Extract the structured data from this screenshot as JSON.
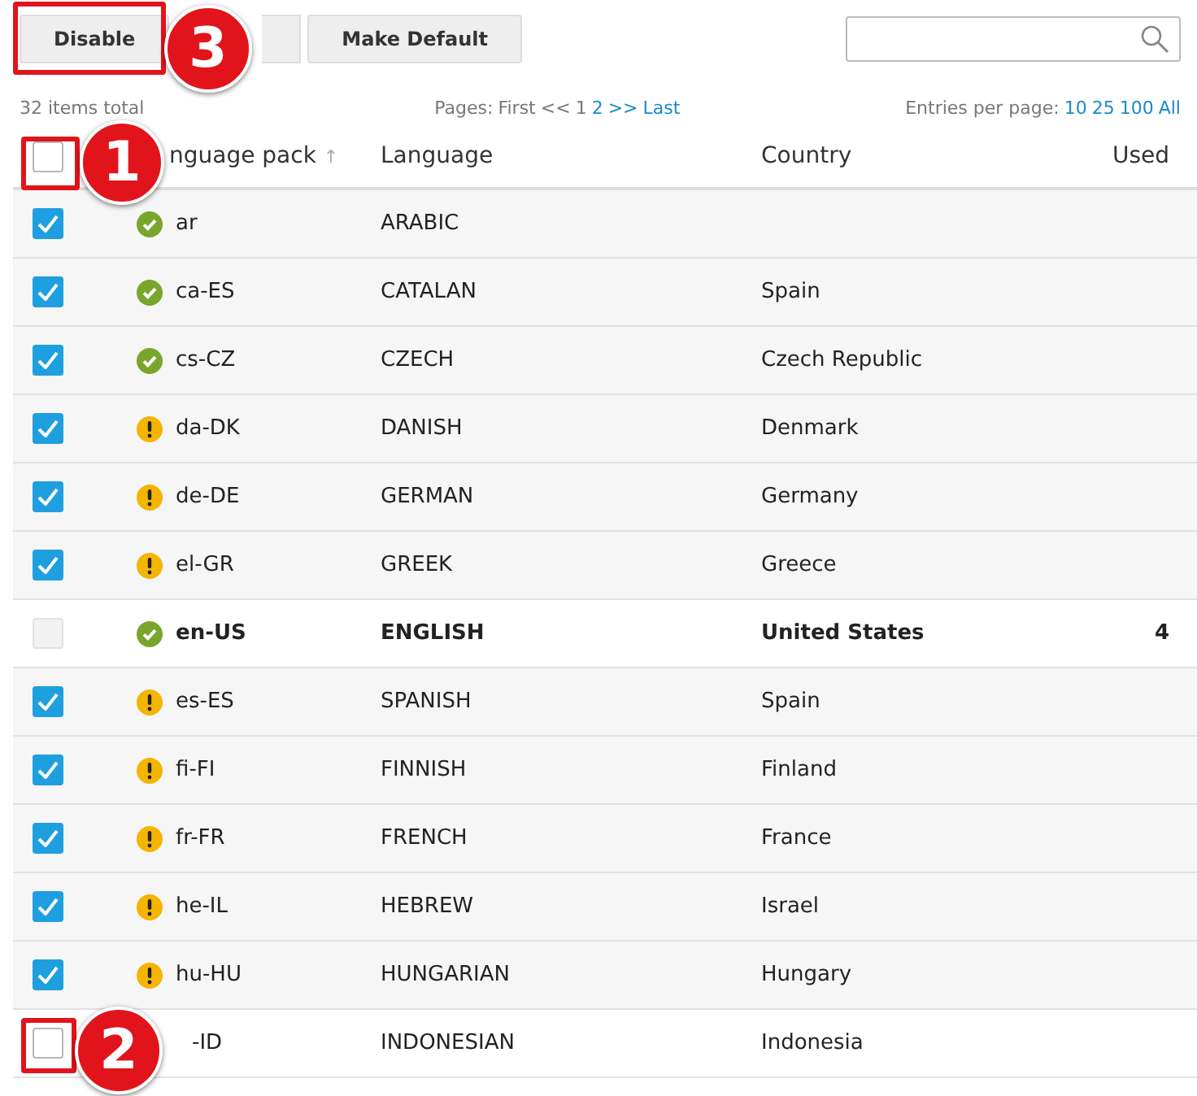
{
  "toolbar": {
    "buttons": [
      {
        "kind": "labeled",
        "label": "Disable"
      },
      {
        "kind": "covered"
      },
      {
        "kind": "labeled",
        "label": "Make Default"
      }
    ]
  },
  "info": {
    "total": "32 items total",
    "pages_label": "Pages:",
    "pages": [
      {
        "label": "First",
        "link": false
      },
      {
        "label": "<<",
        "link": false
      },
      {
        "label": "1",
        "link": false
      },
      {
        "label": "2",
        "link": true
      },
      {
        "label": ">>",
        "link": true
      },
      {
        "label": "Last",
        "link": true
      }
    ],
    "entries_label": "Entries per page:",
    "entries": [
      "10",
      "25",
      "100",
      "All"
    ]
  },
  "table": {
    "header_checked": false,
    "columns": [
      {
        "label": "nguage pack",
        "sort": "↑"
      },
      {
        "label": "Language"
      },
      {
        "label": "Country"
      },
      {
        "label": "Used"
      }
    ],
    "rows": [
      {
        "checked": true,
        "kind": "ok",
        "code": "ar",
        "language": "ARABIC",
        "default": false
      },
      {
        "checked": true,
        "kind": "ok",
        "code": "ca-ES",
        "language": "CATALAN",
        "country": "Spain",
        "default": false
      },
      {
        "checked": true,
        "kind": "ok",
        "code": "cs-CZ",
        "language": "CZECH",
        "country": "Czech Republic",
        "default": false
      },
      {
        "checked": true,
        "kind": "warning",
        "code": "da-DK",
        "language": "DANISH",
        "country": "Denmark",
        "default": false
      },
      {
        "checked": true,
        "kind": "warning",
        "code": "de-DE",
        "language": "GERMAN",
        "country": "Germany",
        "default": false
      },
      {
        "checked": true,
        "kind": "warning",
        "code": "el-GR",
        "language": "GREEK",
        "country": "Greece",
        "default": false
      },
      {
        "checked": false,
        "kind": "ok",
        "code": "en-US",
        "language": "ENGLISH",
        "country": "United States",
        "used": "4",
        "default": true,
        "disabled": true
      },
      {
        "checked": true,
        "kind": "warning",
        "code": "es-ES",
        "language": "SPANISH",
        "country": "Spain",
        "default": false
      },
      {
        "checked": true,
        "kind": "warning",
        "code": "fi-FI",
        "language": "FINNISH",
        "country": "Finland",
        "default": false
      },
      {
        "checked": true,
        "kind": "warning",
        "code": "fr-FR",
        "language": "FRENCH",
        "country": "France",
        "default": false
      },
      {
        "checked": true,
        "kind": "warning",
        "code": "he-IL",
        "language": "HEBREW",
        "country": "Israel",
        "default": false
      },
      {
        "checked": true,
        "kind": "warning",
        "code": "hu-HU",
        "language": "HUNGARIAN",
        "country": "Hungary",
        "default": false
      },
      {
        "checked": false,
        "kind": "none",
        "code": "-ID",
        "language": "INDONESIAN",
        "country": "Indonesia",
        "default": false
      }
    ]
  },
  "callouts": [
    {
      "number": "1"
    },
    {
      "number": "2"
    },
    {
      "number": "3"
    }
  ]
}
